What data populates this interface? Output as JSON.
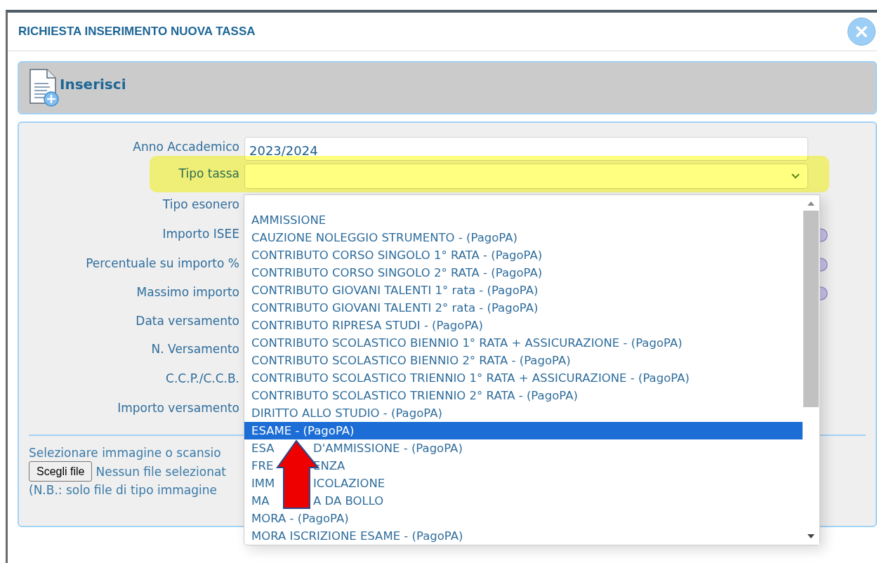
{
  "dialog": {
    "title": "RICHIESTA INSERIMENTO NUOVA TASSA"
  },
  "header": {
    "title": "Inserisci"
  },
  "fields": [
    {
      "label": "Anno Accademico",
      "kind": "text",
      "value": "2023/2024",
      "highlighted": false
    },
    {
      "label": "Tipo tassa",
      "kind": "select",
      "highlighted": true
    },
    {
      "label": "Tipo esonero",
      "kind": "covered",
      "highlighted": false
    },
    {
      "label": "Importo ISEE",
      "kind": "covered_info",
      "highlighted": false
    },
    {
      "label": "Percentuale su importo %",
      "kind": "covered_info",
      "highlighted": false
    },
    {
      "label": "Massimo importo",
      "kind": "covered_info",
      "highlighted": false
    },
    {
      "label": "Data versamento",
      "kind": "covered",
      "highlighted": false
    },
    {
      "label": "N. Versamento",
      "kind": "covered",
      "highlighted": false
    },
    {
      "label": "C.C.P./C.C.B.",
      "kind": "covered",
      "highlighted": false
    },
    {
      "label": "Importo versamento",
      "kind": "covered",
      "highlighted": false
    }
  ],
  "upload": {
    "prompt": "Selezionare immagine o scansio",
    "button": "Scegli file",
    "status": "Nessun file selezionat",
    "note": "(N.B.: solo file di tipo immagine"
  },
  "dropdown": {
    "options": [
      {
        "label": "AMMISSIONE",
        "selected": false
      },
      {
        "label": "CAUZIONE NOLEGGIO STRUMENTO - (PagoPA)",
        "selected": false
      },
      {
        "label": "CONTRIBUTO CORSO SINGOLO 1° RATA - (PagoPA)",
        "selected": false
      },
      {
        "label": "CONTRIBUTO CORSO SINGOLO 2° RATA - (PagoPA)",
        "selected": false
      },
      {
        "label": "CONTRIBUTO GIOVANI TALENTI 1° rata - (PagoPA)",
        "selected": false
      },
      {
        "label": "CONTRIBUTO GIOVANI TALENTI 2° rata - (PagoPA)",
        "selected": false
      },
      {
        "label": "CONTRIBUTO RIPRESA STUDI - (PagoPA)",
        "selected": false
      },
      {
        "label": "CONTRIBUTO SCOLASTICO BIENNIO 1° RATA + ASSICURAZIONE - (PagoPA)",
        "selected": false
      },
      {
        "label": "CONTRIBUTO SCOLASTICO BIENNIO 2° RATA - (PagoPA)",
        "selected": false
      },
      {
        "label": "CONTRIBUTO SCOLASTICO TRIENNIO 1° RATA + ASSICURAZIONE - (PagoPA)",
        "selected": false
      },
      {
        "label": "CONTRIBUTO SCOLASTICO TRIENNIO 2° RATA - (PagoPA)",
        "selected": false
      },
      {
        "label": "DIRITTO ALLO STUDIO - (PagoPA)",
        "selected": false
      },
      {
        "label": "ESAME - (PagoPA)",
        "selected": true
      },
      {
        "parts": [
          "ESA",
          "D'AMMISSIONE - (PagoPA)"
        ],
        "selected": false
      },
      {
        "parts": [
          "FRE",
          "ENZA"
        ],
        "selected": false
      },
      {
        "parts": [
          "IMM",
          "ICOLAZIONE"
        ],
        "selected": false
      },
      {
        "parts": [
          "MA",
          "A DA BOLLO"
        ],
        "selected": false
      },
      {
        "label": "MORA - (PagoPA)",
        "selected": false
      },
      {
        "label": "MORA ISCRIZIONE ESAME - (PagoPA)",
        "selected": false
      }
    ]
  }
}
